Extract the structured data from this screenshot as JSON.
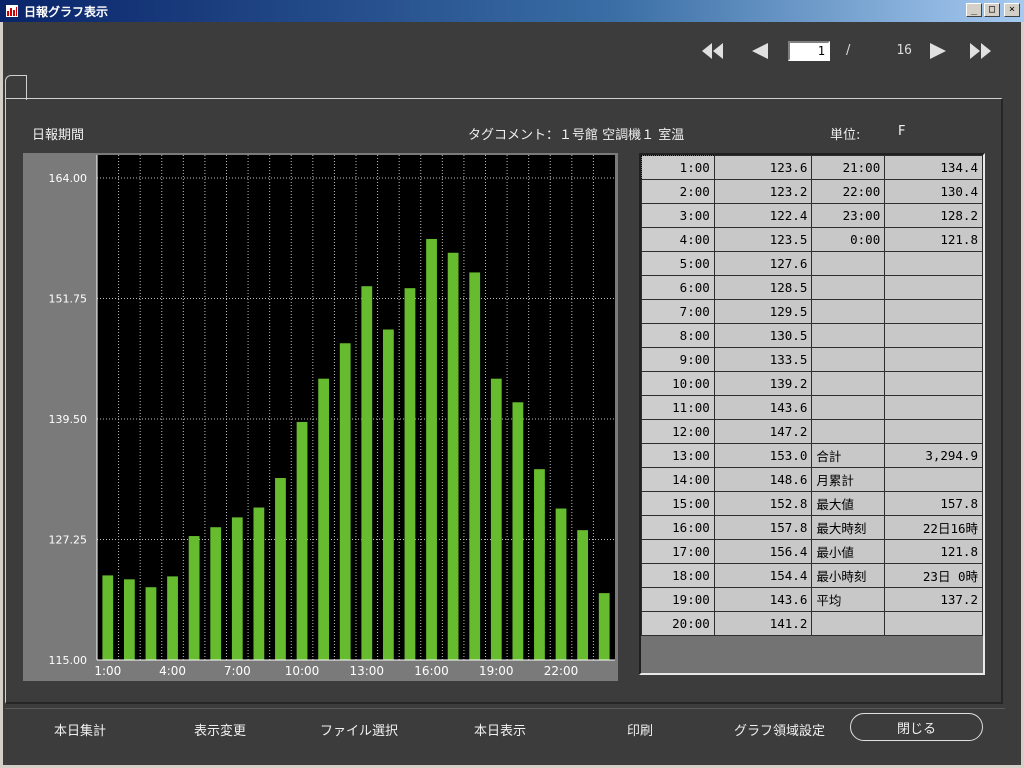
{
  "window": {
    "title": "日報グラフ表示",
    "buttons": {
      "minimize": "_",
      "maximize": "□",
      "close": "×"
    }
  },
  "pager": {
    "current_page": "1",
    "separator": "/",
    "total_pages": "16"
  },
  "header": {
    "period_label": "日報期間",
    "tag_comment": "タグコメント：１号館 空調機１ 室温",
    "unit_label": "単位:",
    "unit_value": "F"
  },
  "chart_data": {
    "type": "bar",
    "categories": [
      "1:00",
      "2:00",
      "3:00",
      "4:00",
      "5:00",
      "6:00",
      "7:00",
      "8:00",
      "9:00",
      "10:00",
      "11:00",
      "12:00",
      "13:00",
      "14:00",
      "15:00",
      "16:00",
      "17:00",
      "18:00",
      "19:00",
      "20:00",
      "21:00",
      "22:00",
      "23:00",
      "0:00"
    ],
    "values": [
      123.6,
      123.2,
      122.4,
      123.5,
      127.6,
      128.5,
      129.5,
      130.5,
      133.5,
      139.2,
      143.6,
      147.2,
      153.0,
      148.6,
      152.8,
      157.8,
      156.4,
      154.4,
      143.6,
      141.2,
      134.4,
      130.4,
      128.2,
      121.8
    ],
    "ylim": [
      115.0,
      164.0
    ],
    "yticks": [
      "115.00",
      "127.25",
      "139.50",
      "151.75",
      "164.00"
    ],
    "xtick_labels": [
      "1:00",
      "4:00",
      "7:00",
      "10:00",
      "13:00",
      "16:00",
      "19:00",
      "22:00"
    ],
    "bar_color": "#66bb2e",
    "plot_background": "#000000",
    "grid": true
  },
  "table": {
    "rows": [
      {
        "time": "1:00",
        "value": "123.6",
        "label": "21:00",
        "label_value": "134.4",
        "label_is_time": true
      },
      {
        "time": "2:00",
        "value": "123.2",
        "label": "22:00",
        "label_value": "130.4",
        "label_is_time": true
      },
      {
        "time": "3:00",
        "value": "122.4",
        "label": "23:00",
        "label_value": "128.2",
        "label_is_time": true
      },
      {
        "time": "4:00",
        "value": "123.5",
        "label": "0:00",
        "label_value": "121.8",
        "label_is_time": true
      },
      {
        "time": "5:00",
        "value": "127.6",
        "label": "",
        "label_value": ""
      },
      {
        "time": "6:00",
        "value": "128.5",
        "label": "",
        "label_value": ""
      },
      {
        "time": "7:00",
        "value": "129.5",
        "label": "",
        "label_value": ""
      },
      {
        "time": "8:00",
        "value": "130.5",
        "label": "",
        "label_value": ""
      },
      {
        "time": "9:00",
        "value": "133.5",
        "label": "",
        "label_value": ""
      },
      {
        "time": "10:00",
        "value": "139.2",
        "label": "",
        "label_value": ""
      },
      {
        "time": "11:00",
        "value": "143.6",
        "label": "",
        "label_value": ""
      },
      {
        "time": "12:00",
        "value": "147.2",
        "label": "",
        "label_value": ""
      },
      {
        "time": "13:00",
        "value": "153.0",
        "label": "合計",
        "label_value": "3,294.9"
      },
      {
        "time": "14:00",
        "value": "148.6",
        "label": "月累計",
        "label_value": ""
      },
      {
        "time": "15:00",
        "value": "152.8",
        "label": "最大値",
        "label_value": "157.8"
      },
      {
        "time": "16:00",
        "value": "157.8",
        "label": "最大時刻",
        "label_value": "22日16時"
      },
      {
        "time": "17:00",
        "value": "156.4",
        "label": "最小値",
        "label_value": "121.8"
      },
      {
        "time": "18:00",
        "value": "154.4",
        "label": "最小時刻",
        "label_value": "23日 0時"
      },
      {
        "time": "19:00",
        "value": "143.6",
        "label": "平均",
        "label_value": "137.2"
      },
      {
        "time": "20:00",
        "value": "141.2",
        "label": "",
        "label_value": ""
      }
    ]
  },
  "bottom_buttons": {
    "daily_total": "本日集計",
    "change_view": "表示変更",
    "select_file": "ファイル選択",
    "show_today": "本日表示",
    "print": "印刷",
    "graph_range": "グラフ領域設定",
    "close": "閉じる"
  }
}
